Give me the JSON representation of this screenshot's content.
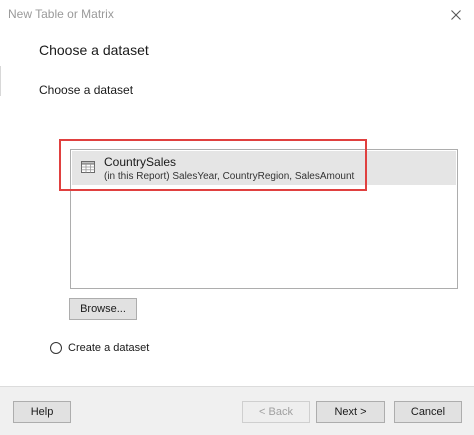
{
  "window": {
    "title": "New Table or Matrix",
    "close_icon": "close-icon"
  },
  "header": {
    "title": "Choose a dataset"
  },
  "section": {
    "label": "Choose a dataset"
  },
  "datasets": [
    {
      "name": "CountrySales",
      "fields": "(in this Report) SalesYear, CountryRegion, SalesAmount",
      "icon": "table-icon",
      "selected": true
    }
  ],
  "browse_button": {
    "label": "Browse..."
  },
  "create_option": {
    "label": "Create a dataset",
    "checked": false
  },
  "footer": {
    "help_label": "Help",
    "back_label": "< Back",
    "next_label": "Next >",
    "cancel_label": "Cancel"
  },
  "colors": {
    "highlight_border": "#e0403f",
    "selected_row": "#e5e5e5",
    "footer_bg": "#f0f0f0"
  }
}
